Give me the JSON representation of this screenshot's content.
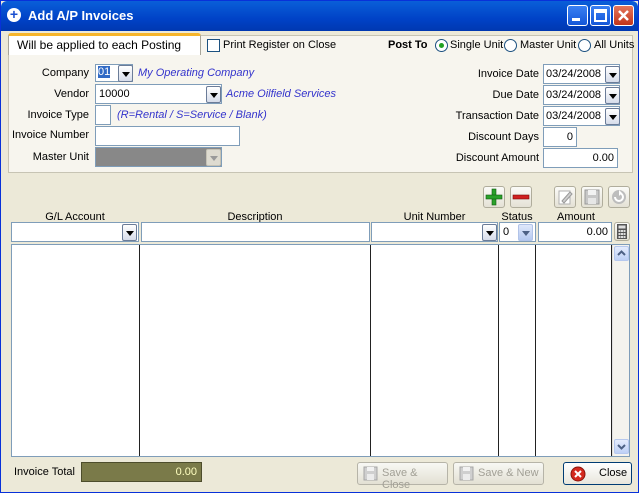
{
  "window": {
    "title": "Add A/P Invoices",
    "title_icon": "plus-icon"
  },
  "header": {
    "tab_label": "Will be applied to each Posting",
    "print_register_label": "Print Register on Close",
    "print_register_checked": false,
    "post_to_label": "Post To",
    "post_to_options": [
      {
        "label": "Single Unit",
        "selected": true
      },
      {
        "label": "Master Unit",
        "selected": false
      },
      {
        "label": "All Units",
        "selected": false
      }
    ]
  },
  "form": {
    "company_label": "Company",
    "company_value": "01",
    "company_name": "My Operating Company",
    "vendor_label": "Vendor",
    "vendor_value": "10000",
    "vendor_name": "Acme Oilfield Services",
    "invoice_type_label": "Invoice Type",
    "invoice_type_value": "",
    "invoice_type_hint": "(R=Rental / S=Service / Blank)",
    "invoice_number_label": "Invoice Number",
    "invoice_number_value": "",
    "master_unit_label": "Master Unit",
    "master_unit_value": "",
    "invoice_date_label": "Invoice Date",
    "invoice_date_value": "03/24/2008",
    "due_date_label": "Due Date",
    "due_date_value": "03/24/2008",
    "transaction_date_label": "Transaction Date",
    "transaction_date_value": "03/24/2008",
    "discount_days_label": "Discount Days",
    "discount_days_value": "0",
    "discount_amount_label": "Discount Amount",
    "discount_amount_value": "0.00"
  },
  "grid": {
    "columns": [
      "G/L Account",
      "Description",
      "Unit Number",
      "Status",
      "Amount"
    ],
    "entry_row": {
      "gl_account": "",
      "description": "",
      "unit_number": "",
      "status": "0",
      "amount": "0.00"
    }
  },
  "footer": {
    "invoice_total_label": "Invoice Total",
    "invoice_total_value": "0.00",
    "save_close_label": "Save & Close",
    "save_new_label": "Save & New",
    "close_label": "Close"
  },
  "colors": {
    "title_bar": "#0042c7",
    "add_icon": "#2aa12a",
    "remove_icon": "#d02020",
    "total_box": "#7a7a49"
  }
}
